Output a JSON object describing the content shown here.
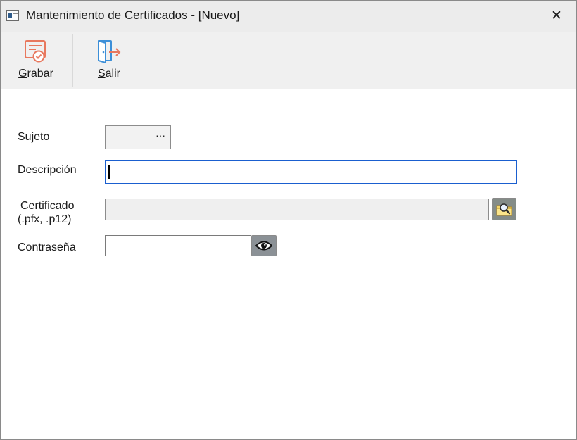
{
  "window": {
    "title": "Mantenimiento de Certificados - [Nuevo]",
    "close_glyph": "✕"
  },
  "toolbar": {
    "buttons": [
      {
        "label": "Grabar",
        "mnemonic": "G",
        "label_rest": "rabar",
        "icon": "save-certificate-icon"
      },
      {
        "label": "Salir",
        "mnemonic": "S",
        "label_rest": "alir",
        "icon": "exit-door-icon"
      }
    ]
  },
  "form": {
    "sujeto": {
      "label": "Sujeto",
      "value": "",
      "button_glyph": "···"
    },
    "descripcion": {
      "label": "Descripción",
      "value": ""
    },
    "certificado": {
      "label_line1": "Certificado",
      "label_line2": "(.pfx, .p12)",
      "value": "",
      "browse_icon": "folder-search-icon"
    },
    "contrasena": {
      "label": "Contraseña",
      "value": "",
      "toggle_icon": "eye-icon"
    }
  },
  "colors": {
    "accent_focus": "#1a5fcf",
    "icon_accent": "#e8785e",
    "icon_blue": "#3c8fd8"
  }
}
